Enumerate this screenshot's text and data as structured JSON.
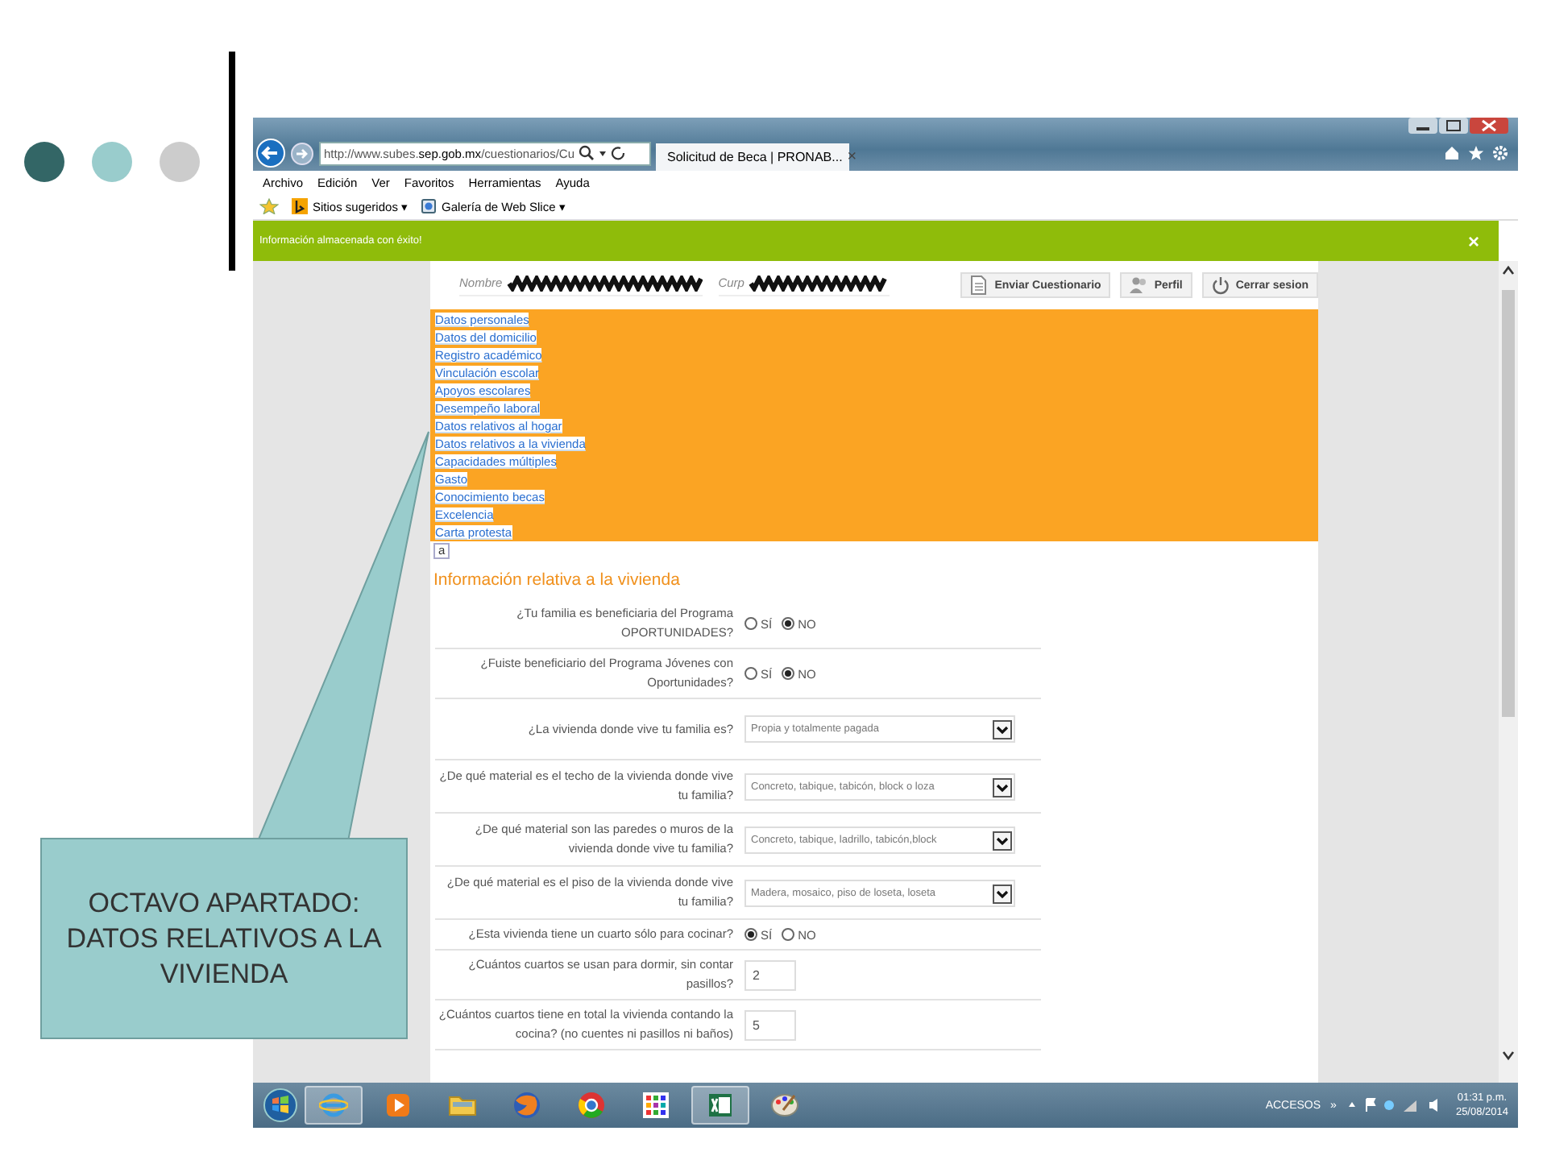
{
  "slide": {
    "dots": [
      {
        "color": "#336666"
      },
      {
        "color": "#99cccc"
      },
      {
        "color": "#cccccc"
      }
    ],
    "callout": {
      "text": "OCTAVO APARTADO: DATOS RELATIVOS A LA VIVIENDA"
    }
  },
  "browser": {
    "address": "http://www.subes.**sep.gob.mx**/cuestionarios/Cu",
    "tab": "Solicitud de Beca | PRONAB...",
    "tab_close": "×",
    "menu": [
      "Archivo",
      "Edición",
      "Ver",
      "Favoritos",
      "Herramientas",
      "Ayuda"
    ],
    "favorites": [
      "Sitios sugeridos ▾",
      "Galería de Web Slice ▾"
    ],
    "notification": {
      "text": "Información almacenada con éxito!",
      "close": "×"
    }
  },
  "page": {
    "header": {
      "fields": [
        "Nombre",
        "Curp"
      ],
      "buttons": [
        {
          "kind": "doc",
          "label": "Enviar Cuestionario"
        },
        {
          "kind": "user",
          "label": "Perfil"
        },
        {
          "kind": "power",
          "label": "Cerrar sesion"
        }
      ]
    },
    "nav_links": [
      {
        "label": "Datos personales"
      },
      {
        "label": "Datos del domicilio"
      },
      {
        "label": "Registro académico"
      },
      {
        "label": "Vinculación escolar"
      },
      {
        "label": "Apoyos escolares"
      },
      {
        "label": "Desempeño laboral"
      },
      {
        "label": "Datos relativos al hogar"
      },
      {
        "label": "Datos relativos a la vivienda"
      },
      {
        "label": "Capacidades múltiples"
      },
      {
        "label": "Gasto"
      },
      {
        "label": "Conocimiento becas"
      },
      {
        "label": "Excelencia"
      },
      {
        "label": "Carta protesta"
      }
    ],
    "nav_extra": "a",
    "section_title": "Información relativa a la vivienda",
    "questions": [
      {
        "kind": "radio",
        "label": "¿Tu familia es beneficiaria del Programa OPORTUNIDADES?",
        "options": [
          {
            "label": "SÍ",
            "selected": false
          },
          {
            "label": "NO",
            "selected": true
          }
        ]
      },
      {
        "kind": "radio",
        "label": "¿Fuiste beneficiario del Programa Jóvenes con Oportunidades?",
        "options": [
          {
            "label": "SÍ",
            "selected": false
          },
          {
            "label": "NO",
            "selected": true
          }
        ]
      },
      {
        "kind": "select",
        "label": "¿La vivienda donde vive tu familia es?",
        "value": "Propia y totalmente pagada"
      },
      {
        "kind": "select",
        "label": "¿De qué material es el techo de la vivienda donde vive tu familia?",
        "value": "Concreto, tabique, tabicón, block o loza"
      },
      {
        "kind": "select",
        "label": "¿De qué material son las paredes o muros de la vivienda donde vive tu familia?",
        "value": "Concreto, tabique, ladrillo, tabicón,block"
      },
      {
        "kind": "select",
        "label": "¿De qué material es el piso de la vivienda donde vive tu familia?",
        "value": "Madera, mosaico, piso de loseta, loseta"
      },
      {
        "kind": "radio",
        "label": "¿Esta vivienda tiene un cuarto sólo para cocinar?",
        "options": [
          {
            "label": "SÍ",
            "selected": true
          },
          {
            "label": "NO",
            "selected": false
          }
        ]
      },
      {
        "kind": "text",
        "label": "¿Cuántos cuartos se usan para dormir, sin contar pasillos?",
        "value": "2"
      },
      {
        "kind": "text",
        "label": "¿Cuántos cuartos tiene en total la vivienda contando la cocina? (no cuentes ni pasillos ni baños)",
        "value": "5"
      }
    ]
  },
  "taskbar": {
    "apps": [
      {
        "kind": "ie",
        "selected": true
      },
      {
        "kind": "media",
        "selected": false
      },
      {
        "kind": "folder",
        "selected": false
      },
      {
        "kind": "fox",
        "selected": false
      },
      {
        "kind": "chrome",
        "selected": false
      },
      {
        "kind": "grid",
        "selected": false
      },
      {
        "kind": "excel",
        "selected": true
      },
      {
        "kind": "paint",
        "selected": false
      }
    ],
    "toolbar_label": "ACCESOS",
    "toolbar_more": "»",
    "time": "01:31 p.m.",
    "date": "25/08/2014"
  }
}
